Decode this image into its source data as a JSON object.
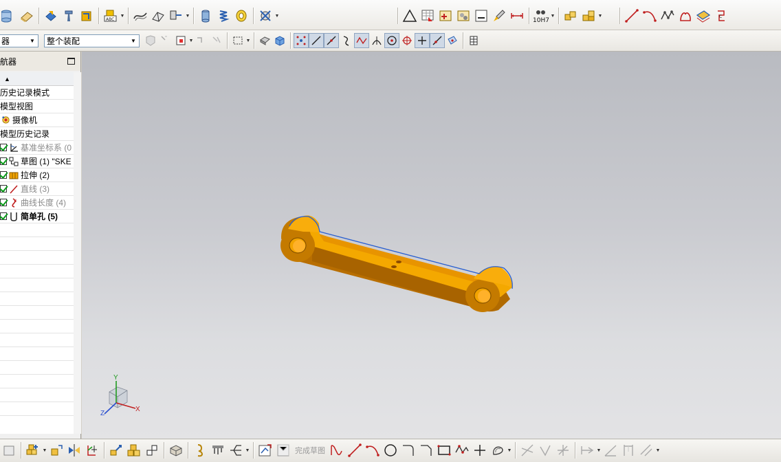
{
  "toolbar2": {
    "filter_value": "器",
    "assembly_value": "整个装配"
  },
  "navigator": {
    "title": "航器",
    "sort_arrow": "▲",
    "rows": [
      {
        "label": "历史记录模式",
        "icon": "none"
      },
      {
        "label": "模型视图",
        "icon": "none"
      },
      {
        "label": "摄像机",
        "icon": "camera-icon"
      },
      {
        "label": "模型历史记录",
        "icon": "none"
      },
      {
        "label": "基准坐标系 (0",
        "icon": "datum-csys-icon",
        "checked": true,
        "style": "grey"
      },
      {
        "label": "草图 (1) \"SKE",
        "icon": "sketch-icon",
        "checked": true,
        "style": "normal"
      },
      {
        "label": "拉伸 (2)",
        "icon": "extrude-icon",
        "checked": true,
        "style": "normal"
      },
      {
        "label": "直线 (3)",
        "icon": "line-icon",
        "checked": true,
        "style": "grey"
      },
      {
        "label": "曲线长度 (4)",
        "icon": "curve-length-icon",
        "checked": true,
        "style": "grey"
      },
      {
        "label": "简单孔 (5)",
        "icon": "hole-icon",
        "checked": true,
        "style": "bold"
      }
    ]
  },
  "viewport": {
    "part_color": "#f5a800",
    "axis_labels": {
      "x": "X",
      "y": "Y",
      "z": "Z"
    }
  },
  "bottom_toolbar": {
    "finish_sketch_label": "完成草图"
  },
  "colors": {
    "accent_blue": "#2a5fb0",
    "check_green": "#0a9a1a"
  }
}
